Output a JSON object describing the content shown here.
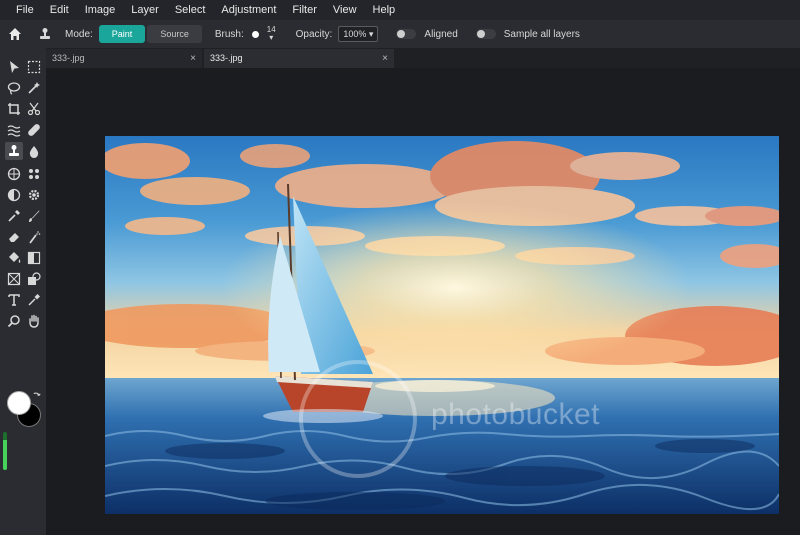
{
  "menu": [
    "File",
    "Edit",
    "Image",
    "Layer",
    "Select",
    "Adjustment",
    "Filter",
    "View",
    "Help"
  ],
  "options": {
    "mode_label": "Mode:",
    "mode_paint": "Paint",
    "mode_source": "Source",
    "brush_label": "Brush:",
    "brush_size": "14",
    "opacity_label": "Opacity:",
    "opacity_value": "100%",
    "aligned_label": "Aligned",
    "sample_all_label": "Sample all layers"
  },
  "tabs": [
    {
      "label": "333-.jpg",
      "close": "×"
    },
    {
      "label": "333-.jpg",
      "close": "×"
    }
  ],
  "canvas": {
    "watermark_text": "photobucket"
  },
  "colors": {
    "accent": "#1aa69a",
    "foreground": "#ffffff",
    "background": "#000000",
    "level": "#46d15b"
  },
  "level_fraction": 0.8
}
